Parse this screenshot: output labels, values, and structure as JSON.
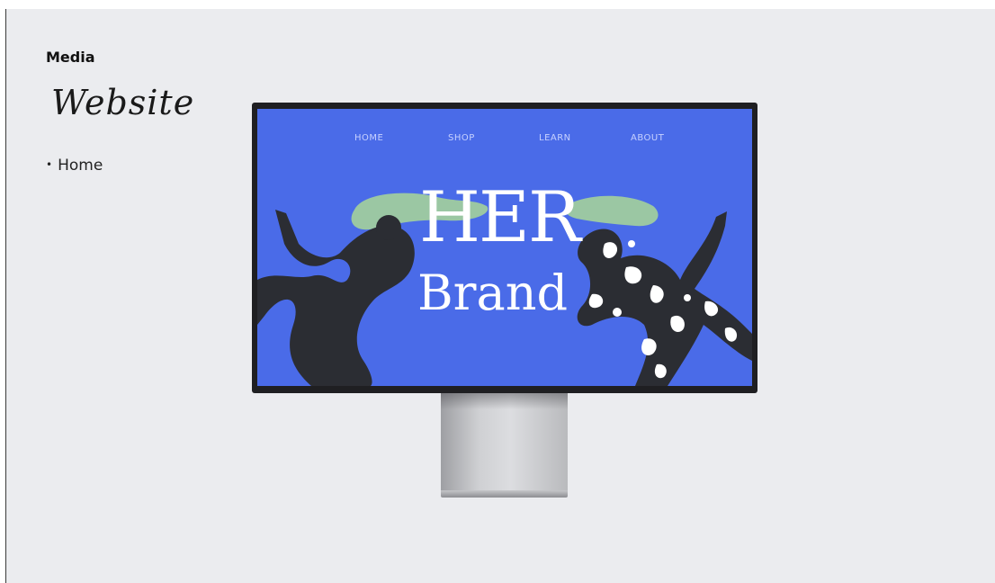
{
  "sidebar": {
    "section_label": "Media",
    "section_title": "Website",
    "items": [
      {
        "label": "Home",
        "bullet": "•"
      }
    ]
  },
  "mockup": {
    "nav": [
      "HOME",
      "SHOP",
      "LEARN",
      "ABOUT"
    ],
    "hero_line1": "HER",
    "hero_line2": "Brand",
    "colors": {
      "screen_background": "#4a6be8",
      "hair_green": "#9bc7a3",
      "figure_dark": "#2b2d33",
      "bezel": "#1f1f22",
      "page_background": "#ebecef"
    }
  }
}
